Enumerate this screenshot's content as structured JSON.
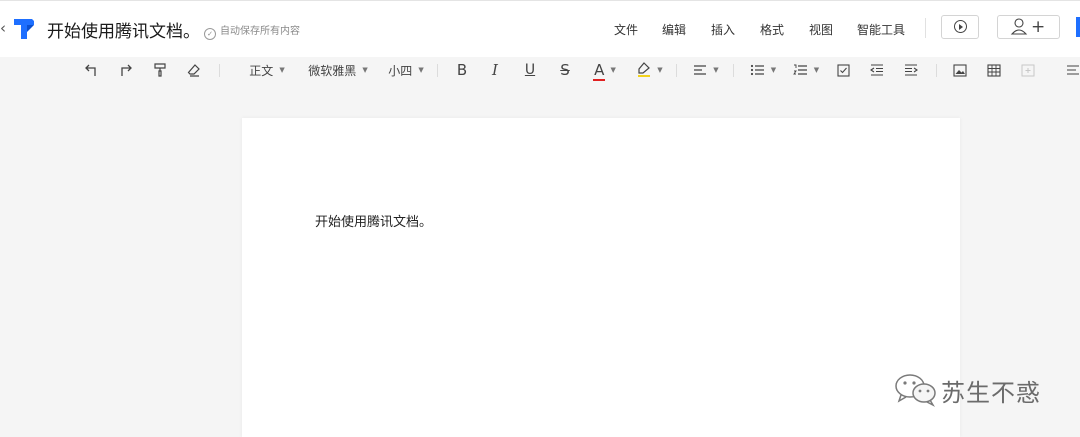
{
  "header": {
    "back_glyph": "‹",
    "doc_title": "开始使用腾讯文档。",
    "save_status": "自动保存所有内容",
    "menu": [
      "文件",
      "编辑",
      "插入",
      "格式",
      "视图",
      "智能工具"
    ],
    "share_plus": "+"
  },
  "toolbar": {
    "paragraph_style": "正文",
    "font_family": "微软雅黑",
    "font_size": "小四",
    "bold": "B",
    "italic": "I",
    "underline": "U",
    "strike": "S",
    "font_color_letter": "A",
    "caret": "▼"
  },
  "document": {
    "body_text": "开始使用腾讯文档。"
  },
  "watermark": {
    "text": "苏生不惑"
  },
  "colors": {
    "brand_blue": "#1e6fff",
    "font_color_bar": "#e02020",
    "highlight_bar": "#f2d21b"
  },
  "icons": {
    "logo": "tencent-docs-logo",
    "save_check": "check-circle-icon",
    "present": "play-circle-icon",
    "share": "person-add-icon",
    "wechat": "wechat-icon"
  }
}
